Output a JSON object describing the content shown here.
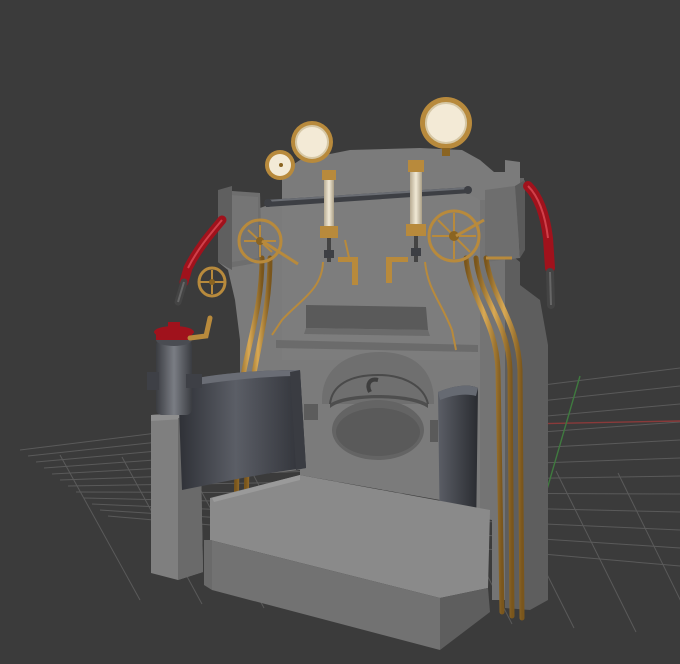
{
  "viewport": {
    "background": "#3b3b3b",
    "grid_color": "#5a5a5a",
    "axis_x_color": "#8a3a3a",
    "axis_y_color": "#3f7a3f"
  },
  "model": {
    "body_color": "#7c7c7c",
    "body_shadow": "#636363",
    "body_dark": "#4f4f4f",
    "brass": "#b88a3c",
    "brass_dark": "#8a6422",
    "red": "#a0121c",
    "gauge_face": "#f3ead6",
    "door_color": "#4e5057",
    "icons": [
      "pressure-gauge-icon",
      "valve-wheel-icon",
      "water-gauge-icon",
      "firebox-door-icon",
      "regulator-handle-icon"
    ]
  }
}
